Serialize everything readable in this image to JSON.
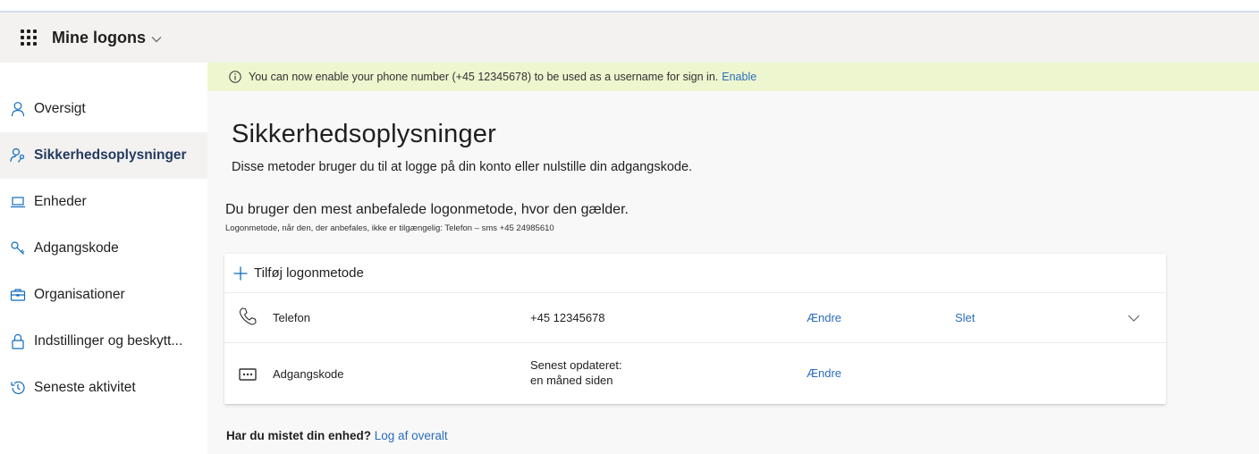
{
  "app": {
    "title": "Mine logons"
  },
  "sidebar": {
    "items": [
      {
        "label": "Oversigt",
        "icon": "person-icon"
      },
      {
        "label": "Sikkerhedsoplysninger",
        "icon": "person-key-icon"
      },
      {
        "label": "Enheder",
        "icon": "laptop-icon"
      },
      {
        "label": "Adgangskode",
        "icon": "key-icon"
      },
      {
        "label": "Organisationer",
        "icon": "briefcase-icon"
      },
      {
        "label": "Indstillinger og beskytt...",
        "icon": "lock-icon"
      },
      {
        "label": "Seneste aktivitet",
        "icon": "history-icon"
      }
    ],
    "active_index": 1
  },
  "banner": {
    "text": "You can now enable your phone number (+45 12345678) to be used as a username for sign in.",
    "link": "Enable"
  },
  "main": {
    "title": "Sikkerhedsoplysninger",
    "subtitle": "Disse metoder bruger du til at logge på din konto eller nulstille din adgangskode.",
    "default_method": "Du bruger den mest anbefalede logonmetode, hvor den gælder.",
    "default_method_note": "Logonmetode, når den, der anbefales, ikke er tilgængelig: Telefon – sms +45 24985610",
    "add_method": "Tilføj logonmetode",
    "methods": [
      {
        "name": "Telefon",
        "value": "+45 12345678",
        "change": "Ændre",
        "delete": "Slet",
        "icon": "phone-icon"
      },
      {
        "name": "Adgangskode",
        "value_line1": "Senest opdateret:",
        "value_line2": "en måned siden",
        "change": "Ændre",
        "icon": "password-icon"
      }
    ],
    "lost_device_question": "Har du mistet din enhed?",
    "lost_device_link": "Log af overalt"
  },
  "colors": {
    "link": "#2b6dbd",
    "banner_bg": "#eef6cf",
    "active_nav_text": "#243a5e",
    "appbar_bg": "#f3f2f1"
  }
}
